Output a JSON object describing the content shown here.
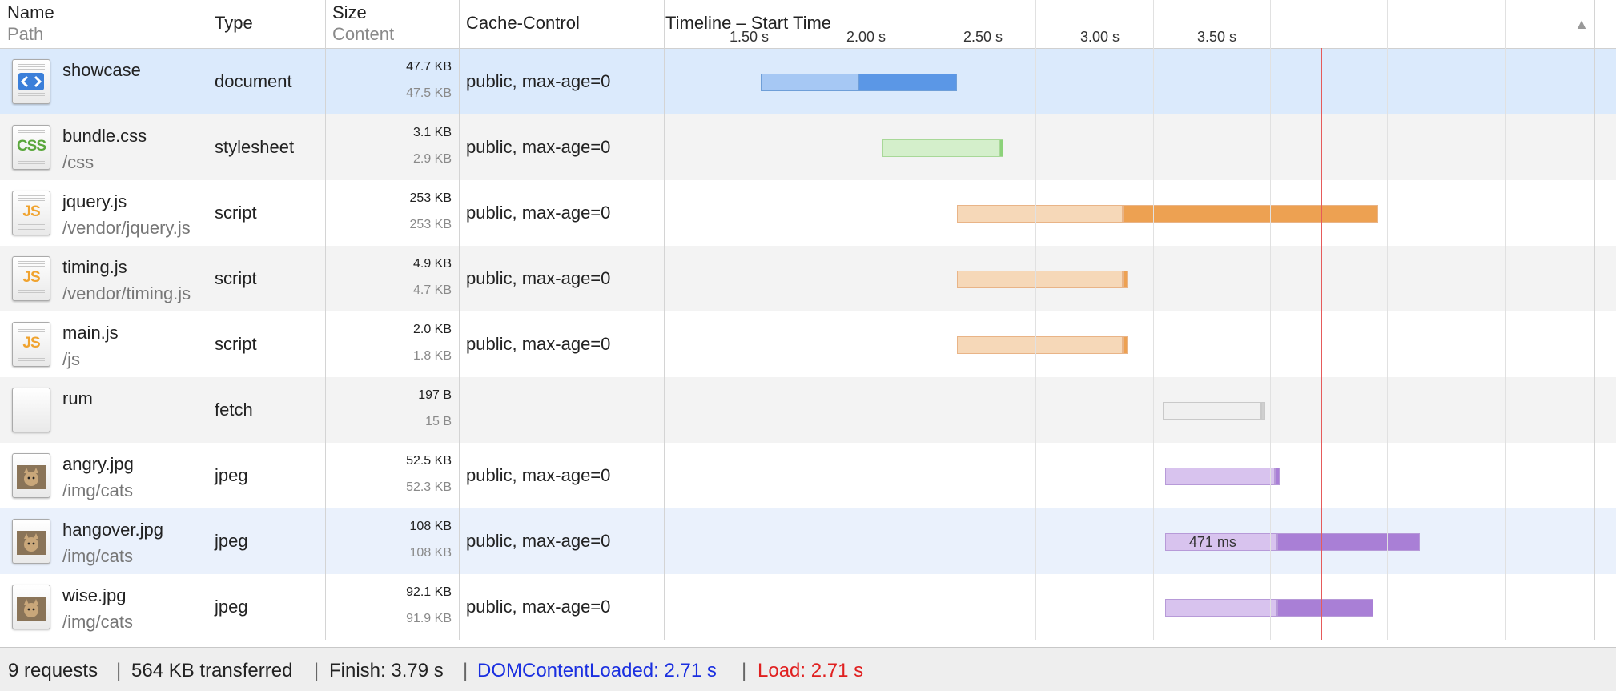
{
  "header": {
    "name_label": "Name",
    "path_label": "Path",
    "type_label": "Type",
    "size_label": "Size",
    "content_label": "Content",
    "cache_label": "Cache-Control",
    "timeline_label": "Timeline – Start Time",
    "ticks": [
      "1.50 s",
      "2.00 s",
      "2.50 s",
      "3.00 s",
      "3.50 s"
    ],
    "sort_icon": "sort-ascending-icon"
  },
  "rows": [
    {
      "name": "showcase",
      "path": "",
      "type": "document",
      "size": "47.7 KB",
      "content": "47.5 KB",
      "cache": "public, max-age=0",
      "icon": "html-document-icon",
      "start": 1.41,
      "waiting_end": 1.83,
      "end": 2.25
    },
    {
      "name": "bundle.css",
      "path": "/css",
      "type": "stylesheet",
      "size": "3.1 KB",
      "content": "2.9 KB",
      "cache": "public, max-age=0",
      "icon": "css-file-icon",
      "start": 1.93,
      "waiting_end": 2.43,
      "end": 2.45
    },
    {
      "name": "jquery.js",
      "path": "/vendor/jquery.js",
      "type": "script",
      "size": "253 KB",
      "content": "253 KB",
      "cache": "public, max-age=0",
      "icon": "js-file-icon",
      "start": 2.25,
      "waiting_end": 2.96,
      "end": 4.05
    },
    {
      "name": "timing.js",
      "path": "/vendor/timing.js",
      "type": "script",
      "size": "4.9 KB",
      "content": "4.7 KB",
      "cache": "public, max-age=0",
      "icon": "js-file-icon",
      "start": 2.25,
      "waiting_end": 2.96,
      "end": 2.98
    },
    {
      "name": "main.js",
      "path": "/js",
      "type": "script",
      "size": "2.0 KB",
      "content": "1.8 KB",
      "cache": "public, max-age=0",
      "icon": "js-file-icon",
      "start": 2.25,
      "waiting_end": 2.96,
      "end": 2.98
    },
    {
      "name": "rum",
      "path": "",
      "type": "fetch",
      "size": "197 B",
      "content": "15 B",
      "cache": "",
      "icon": "blank-file-icon",
      "start": 3.13,
      "waiting_end": 3.55,
      "end": 3.57
    },
    {
      "name": "angry.jpg",
      "path": "/img/cats",
      "type": "jpeg",
      "size": "52.5 KB",
      "content": "52.3 KB",
      "cache": "public, max-age=0",
      "icon": "cat-image-icon",
      "start": 3.14,
      "waiting_end": 3.61,
      "end": 3.63
    },
    {
      "name": "hangover.jpg",
      "path": "/img/cats",
      "type": "jpeg",
      "size": "108 KB",
      "content": "108 KB",
      "cache": "public, max-age=0",
      "icon": "cat-image-icon",
      "start": 3.14,
      "waiting_end": 3.62,
      "end": 4.23,
      "bar_label": "471 ms"
    },
    {
      "name": "wise.jpg",
      "path": "/img/cats",
      "type": "jpeg",
      "size": "92.1 KB",
      "content": "91.9 KB",
      "cache": "public, max-age=0",
      "icon": "cat-image-icon",
      "start": 3.14,
      "waiting_end": 3.62,
      "end": 4.03
    }
  ],
  "timeline": {
    "dom_content_loaded": 2.71,
    "load": 2.71
  },
  "footer": {
    "requests": "9 requests",
    "transferred": "564 KB transferred",
    "finish": "Finish: 3.79 s",
    "dcl": "DOMContentLoaded: 2.71 s",
    "load": "Load: 2.71 s",
    "separator": "|"
  },
  "colors": {
    "document": "#5b97e6",
    "stylesheet": "#8cd27a",
    "script": "#eda152",
    "fetch": "#cfcfcf",
    "jpeg": "#a97fd6",
    "dcl_line": "#0a2fd8",
    "load_line": "#e02020"
  }
}
